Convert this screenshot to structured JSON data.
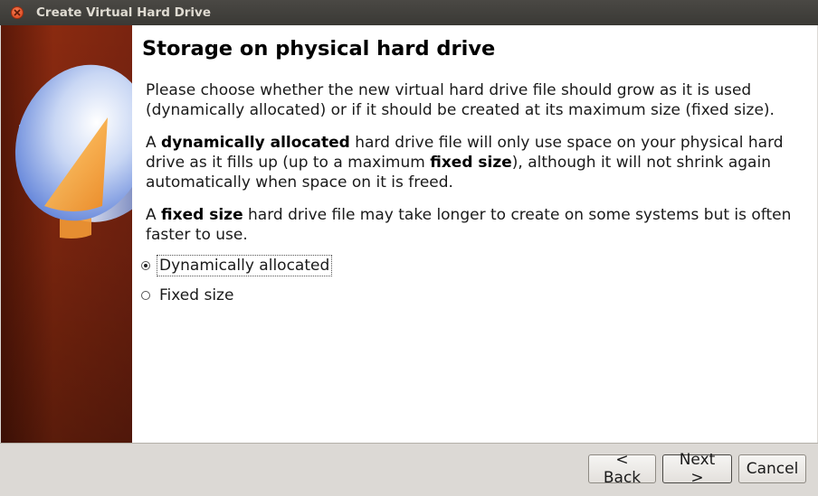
{
  "window": {
    "title": "Create Virtual Hard Drive",
    "close_icon": "close-icon"
  },
  "page": {
    "heading": "Storage on physical hard drive",
    "para1": "Please choose whether the new virtual hard drive file should grow as it is used (dynamically allocated) or if it should be created at its maximum size (fixed size).",
    "para2": {
      "t1": "A ",
      "b1": "dynamically allocated",
      "t2": " hard drive file will only use space on your physical hard drive as it fills up (up to a maximum ",
      "b2": "fixed size",
      "t3": "), although it will not shrink again automatically when space on it is freed."
    },
    "para3": {
      "t1": "A ",
      "b1": "fixed size",
      "t2": " hard drive file may take longer to create on some systems but is often faster to use."
    }
  },
  "options": [
    {
      "label": "Dynamically allocated",
      "selected": true
    },
    {
      "label": "Fixed size",
      "selected": false
    }
  ],
  "buttons": {
    "back": "< Back",
    "next": "Next >",
    "cancel": "Cancel"
  },
  "colors": {
    "sidebar": "#7a2410",
    "disk_top": "#7fa0e8",
    "disk_wedge": "#f5a23a"
  }
}
